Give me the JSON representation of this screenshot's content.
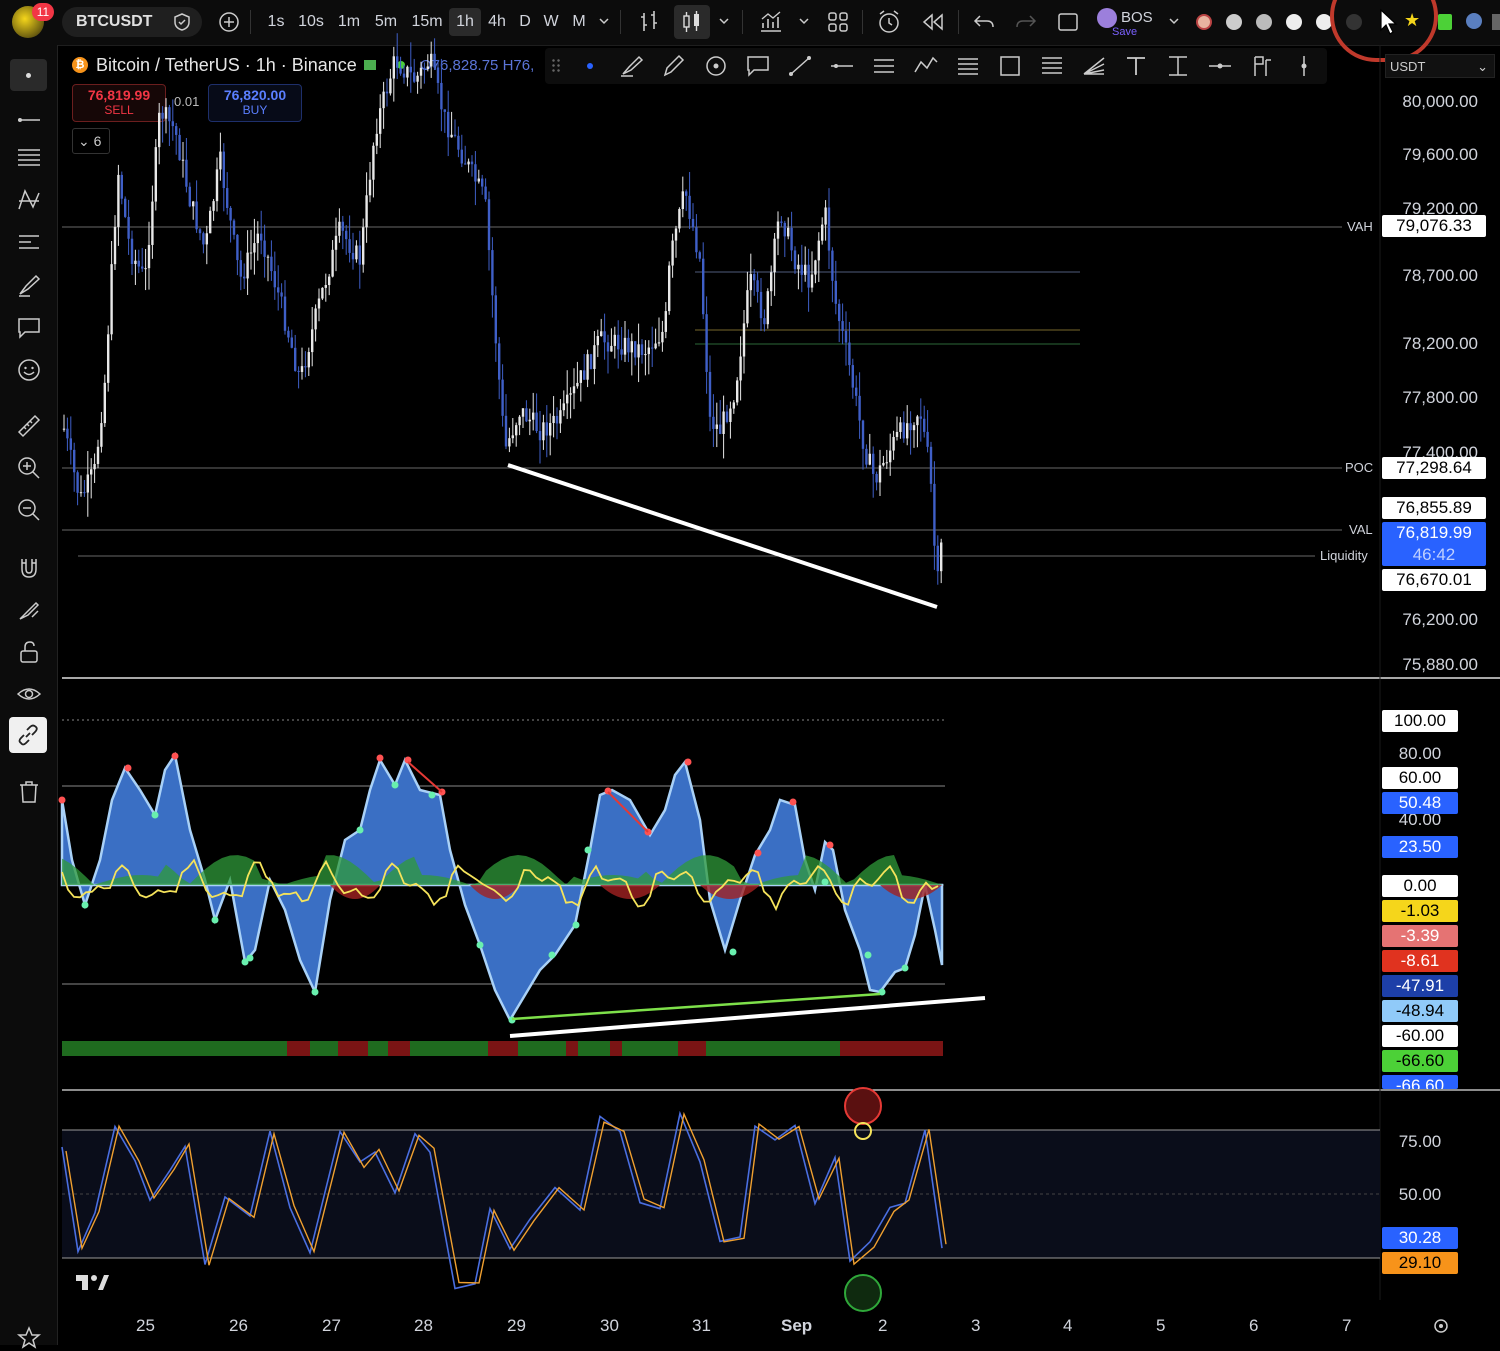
{
  "toolbar": {
    "notification_count": "11",
    "symbol": "BTCUSDT",
    "intervals": [
      "1s",
      "10s",
      "1m",
      "5m",
      "15m",
      "1h",
      "4h",
      "D",
      "W",
      "M"
    ],
    "selected_interval": "1h",
    "indicator_name": "BOS",
    "indicator_sub": "Save"
  },
  "legend": {
    "title": "Bitcoin / TetherUS · 1h · Binance",
    "ohlc": "O76,828.75 H76,",
    "sell_price": "76,819.99",
    "sell_label": "SELL",
    "spread": "0.01",
    "buy_price": "76,820.00",
    "buy_label": "BUY",
    "collapsed_count": "6"
  },
  "currency_select": "USDT",
  "price_axis": {
    "labels": [
      "80,000.00",
      "79,600.00",
      "79,200.00",
      "78,700.00",
      "78,200.00",
      "77,800.00",
      "77,400.00",
      "76,200.00",
      "75,880.00"
    ],
    "vah_label": "VAH",
    "vah_value": "79,076.33",
    "poc_label": "POC",
    "poc_value": "77,298.64",
    "level_1": "76,855.89",
    "val_label": "VAL",
    "val_value": "76,819.99",
    "countdown": "46:42",
    "liquidity_label": "Liquidity",
    "liquidity_value": "76,670.01"
  },
  "osc_axis": {
    "labels": [
      "100.00",
      "80.00",
      "60.00",
      "50.48",
      "40.00",
      "23.50",
      "0.00",
      "-1.03",
      "-3.39",
      "-8.61",
      "-47.91",
      "-48.94",
      "-60.00",
      "-66.60",
      "-66.60"
    ]
  },
  "stoch_axis": {
    "labels": [
      "75.00",
      "50.00",
      "30.28",
      "29.10"
    ]
  },
  "time_axis": {
    "labels": [
      "25",
      "26",
      "27",
      "28",
      "29",
      "30",
      "31",
      "Sep",
      "2",
      "3",
      "4",
      "5",
      "6",
      "7"
    ]
  },
  "colors": {
    "sell": "#f23645",
    "buy": "#2962ff",
    "label_blue": "#2962ff",
    "label_lightblue": "#90caf9",
    "label_yellow": "#f5d61b",
    "label_red": "#f23645",
    "label_salmon": "#e57373",
    "label_green": "#4cd137",
    "label_orange": "#f7931a"
  }
}
